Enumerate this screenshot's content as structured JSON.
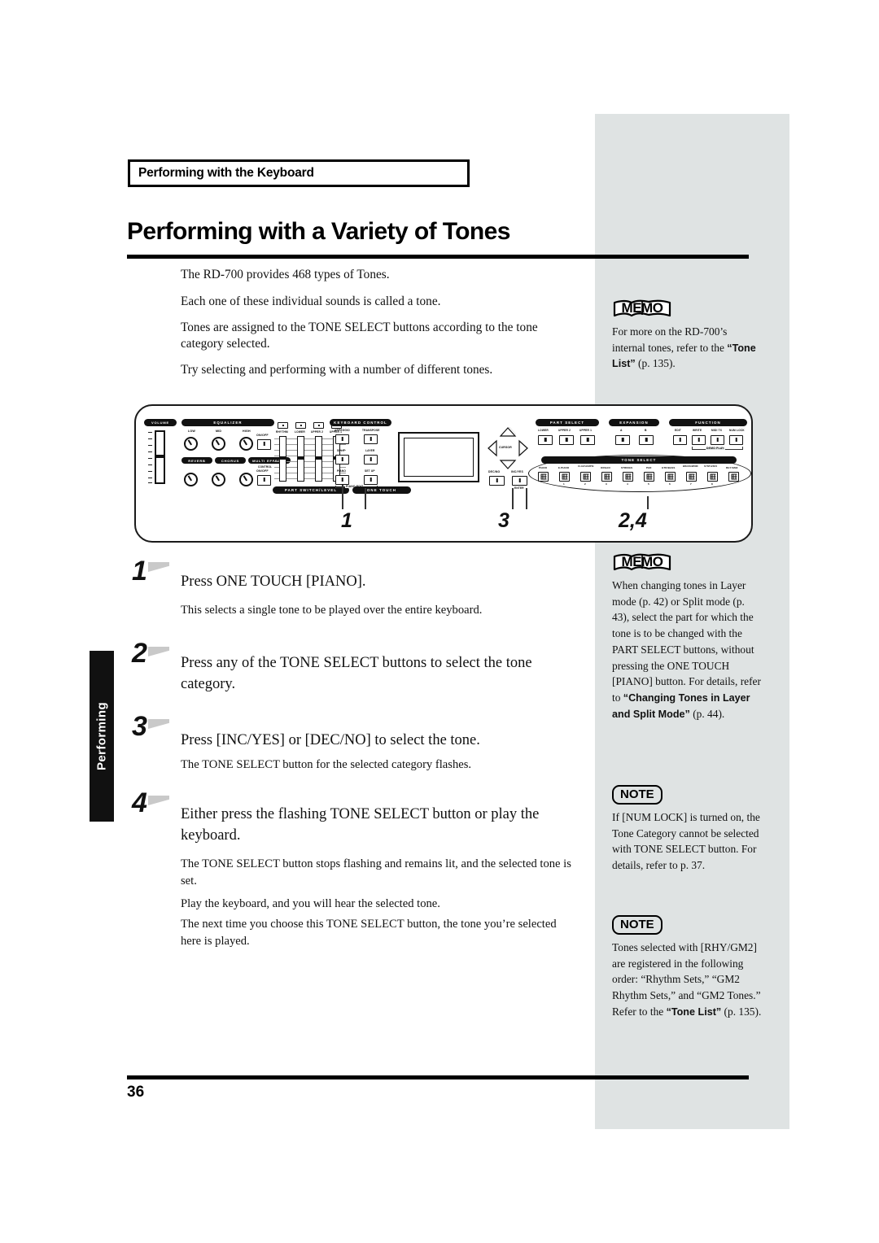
{
  "document": {
    "running_head": "Performing with the Keyboard",
    "title": "Performing with a Variety of Tones",
    "page_number": "36",
    "index_tab": "Performing"
  },
  "intro": {
    "p1": "The RD-700 provides 468 types of Tones.",
    "p2": "Each one of these individual sounds is called a tone.",
    "p3": "Tones are assigned to the TONE SELECT buttons according to the tone category selected.",
    "p4": "Try selecting and performing with a number of different tones."
  },
  "panel": {
    "callouts": [
      "1",
      "3",
      "2,4"
    ],
    "sections": {
      "volume": "VOLUME",
      "equalizer": "EQUALIZER",
      "reverb": "REVERB",
      "chorus": "CHORUS",
      "multi_effects": "MULTI EFFECTS",
      "part_switch_level": "PART SWITCH/LEVEL",
      "keyboard_control": "KEYBOARD CONTROL",
      "one_touch": "ONE TOUCH",
      "part_select": "PART SELECT",
      "expansion": "EXPANSION",
      "function": "FUNCTION",
      "tone_select": "TONE SELECT"
    },
    "eq_knobs": [
      "LOW",
      "MID",
      "HIGH"
    ],
    "onoff": "ON/OFF",
    "control": "CONTROL",
    "part_faders": [
      "RHYTHM",
      "LOWER",
      "UPPER 2",
      "UPPER 1"
    ],
    "keyboard_control_buttons": [
      "ARPEGGIO",
      "TRANSPOSE",
      "SPLIT",
      "LAYER",
      "PIANO",
      "SET UP"
    ],
    "piano_edit": "PIANO EDIT",
    "cursor": "CURSOR",
    "dec_no": "DEC/NO",
    "inc_yes": "INC/YES",
    "enter": "ENTER",
    "part_select_buttons": [
      "LOWER",
      "UPPER 2",
      "UPPER 1"
    ],
    "expansion_buttons": [
      "A",
      "B"
    ],
    "function_buttons": [
      "EDIT",
      "WRITE",
      "MIDI TX",
      "NUM LOCK"
    ],
    "demo_play": "DEMO PLAY",
    "tone_select_labels": [
      "PIANO",
      "E.PIANO",
      "CLAV/HARPSI",
      "ORGAN",
      "STRINGS",
      "PAD",
      "GTR/BASS",
      "BRASS/WIND",
      "SYNTH/SFX",
      "RHY/GM2"
    ],
    "tone_select_numbers": [
      "",
      "1",
      "2",
      "3",
      "4",
      "5",
      "6",
      "7",
      "8",
      ""
    ]
  },
  "steps": [
    {
      "number": "1",
      "title": "Press ONE TOUCH [PIANO].",
      "body": [
        "This selects a single tone to be played over the entire keyboard."
      ]
    },
    {
      "number": "2",
      "title": "Press any of the TONE SELECT buttons to select the tone category.",
      "body": []
    },
    {
      "number": "3",
      "title": "Press [INC/YES] or [DEC/NO] to select the tone.",
      "body": [
        "The TONE SELECT button for the selected category flashes."
      ]
    },
    {
      "number": "4",
      "title": "Either press the flashing TONE SELECT button or play the keyboard.",
      "body": [
        "The TONE SELECT button stops flashing and remains lit, and the selected tone is set.",
        "Play the keyboard, and you will hear the selected tone.",
        "The next time you choose this TONE SELECT button, the tone you’re selected here is played."
      ]
    }
  ],
  "sidebar": {
    "memo_label": "MEMO",
    "note_label": "NOTE",
    "blocks": [
      {
        "kind": "memo",
        "text_1": "For more on the RD-700’s internal tones, refer to the ",
        "bold_1": "“Tone List”",
        "text_2": " (p. 135)."
      },
      {
        "kind": "memo",
        "text_1": "When changing tones in Layer mode (p. 42) or Split mode (p. 43), select the part for which the tone is to be changed with the PART SELECT buttons, without pressing the ONE TOUCH [PIANO] button. For details, refer to ",
        "bold_1": "“Changing Tones in Layer and Split Mode”",
        "text_2": " (p. 44)."
      },
      {
        "kind": "note",
        "text_1": "If [NUM LOCK] is turned on, the Tone Category cannot be selected with TONE SELECT button. For details, refer to p. 37.",
        "bold_1": "",
        "text_2": ""
      },
      {
        "kind": "note",
        "text_1": "Tones selected with [RHY/GM2] are registered in the following order: “Rhythm Sets,” “GM2 Rhythm Sets,” and “GM2 Tones.” Refer to the ",
        "bold_1": "“Tone List”",
        "text_2": " (p. 135)."
      }
    ]
  },
  "colors": {
    "sidebar_bg": "#dfe3e3",
    "ink": "#111111",
    "tab_bg": "#111111",
    "flag_gray": "#c9c9c9"
  }
}
